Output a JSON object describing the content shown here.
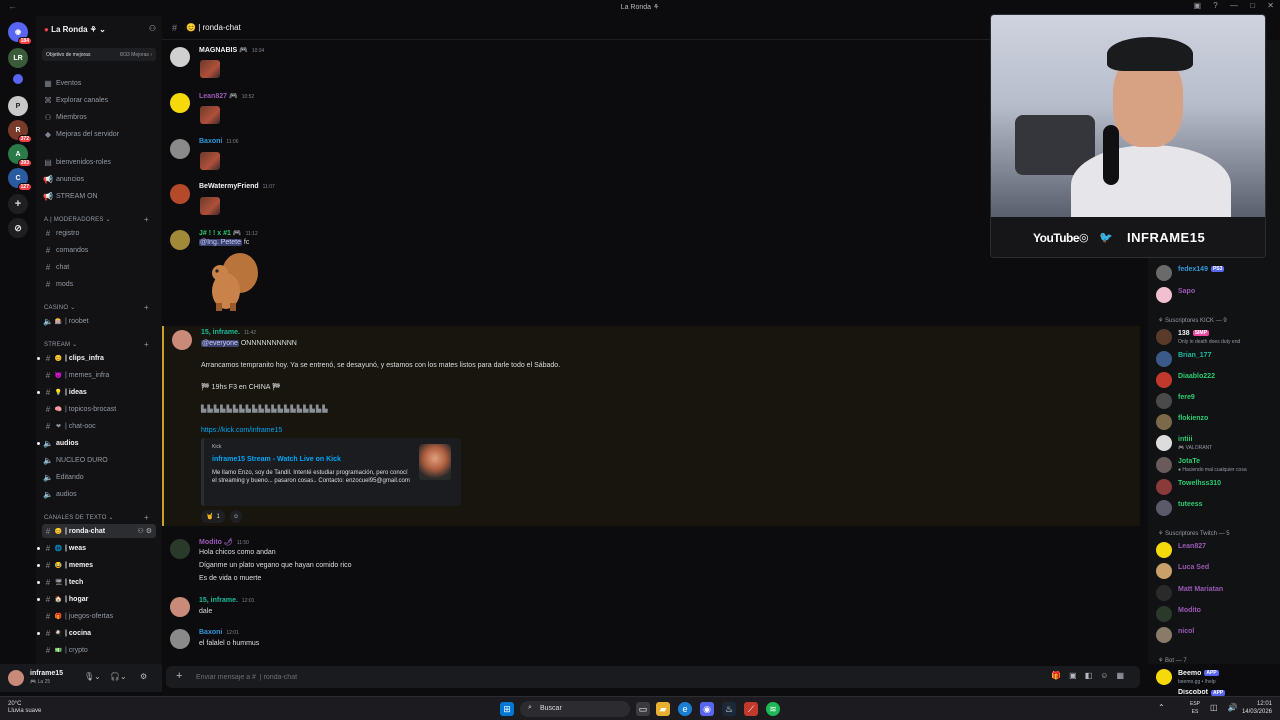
{
  "window": {
    "title": "La Ronda",
    "controls": [
      "—",
      "□",
      "✕"
    ]
  },
  "rail": {
    "servers": [
      {
        "label": "LR",
        "badge": "",
        "color": "#2b2d31"
      },
      {
        "label": "E",
        "badge": "",
        "color": "#5865f2"
      },
      {
        "label": "P",
        "badge": "",
        "color": "#c9c9c9"
      },
      {
        "label": "R",
        "badge": "372",
        "color": "#7a3a2a"
      },
      {
        "label": "A",
        "badge": "393",
        "color": "#2a7a4a"
      },
      {
        "label": "C",
        "badge": "127",
        "color": "#2a5aa0"
      }
    ],
    "top_badge": "184"
  },
  "guild": {
    "name": "La Ronda",
    "goal_label": "Objetivo de mejoras",
    "goal_progress": "8/33 Mejoras"
  },
  "nav_items": [
    {
      "label": "Eventos",
      "icon": "calendar-icon"
    },
    {
      "label": "Explorar canales",
      "icon": "explore-icon"
    },
    {
      "label": "Miembros",
      "icon": "members-icon"
    },
    {
      "label": "Mejoras del servidor",
      "icon": "boost-icon"
    }
  ],
  "channels_top": [
    {
      "label": "bienvenidos-roles",
      "icon": "#"
    },
    {
      "label": "anuncios",
      "icon": "#"
    },
    {
      "label": "STREAM ON",
      "icon": "#"
    }
  ],
  "categories": {
    "mods": "Moderadores",
    "casino": "CASINO",
    "stream": "STREAM",
    "text": "CANALES DE TEXTO"
  },
  "channels_mods": [
    {
      "label": "registro"
    },
    {
      "label": "comandos"
    },
    {
      "label": "chat"
    },
    {
      "label": "mods"
    }
  ],
  "channels_casino": [
    {
      "label": "| roobet"
    }
  ],
  "channels_stream": [
    {
      "label": "| clips_infra",
      "bold": true
    },
    {
      "label": "| memes_infra",
      "bold": false
    },
    {
      "label": "| ideas",
      "bold": true
    },
    {
      "label": "| topicos-brocast",
      "bold": false
    },
    {
      "label": "| chat-ooc",
      "bold": false
    },
    {
      "label": "audios",
      "bold": true
    },
    {
      "label": "NUCLEO DURO",
      "bold": false
    },
    {
      "label": "Editando",
      "bold": false
    },
    {
      "label": "audios",
      "bold": false
    }
  ],
  "channels_text": [
    {
      "label": "| ronda-chat",
      "bold": true,
      "selected": true
    },
    {
      "label": "| weas",
      "bold": true
    },
    {
      "label": "| memes",
      "bold": true
    },
    {
      "label": "| tech",
      "bold": true
    },
    {
      "label": "| hogar",
      "bold": true
    },
    {
      "label": "| juegos-ofertas",
      "bold": false
    },
    {
      "label": "| cocina",
      "bold": true
    },
    {
      "label": "| crypto",
      "bold": false
    }
  ],
  "user": {
    "name": "inframe15",
    "status": "La 25"
  },
  "chat": {
    "channel_title": "| ronda-chat",
    "composer_placeholder": "Enviar mensaje a #  | ronda-chat"
  },
  "messages": [
    {
      "author": "MAGNABIS",
      "time": "10:34",
      "color": "#f2f3f5"
    },
    {
      "author": "Lean827",
      "time": "10:52",
      "color": "#9b59b6"
    },
    {
      "author": "Baxoni",
      "time": "11:06",
      "color": "#3498db"
    },
    {
      "author": "BeWatermyFriend",
      "time": "11:07",
      "color": "#f2f3f5"
    },
    {
      "author": "J# ! ! x #1",
      "time": "11:12",
      "color": "#2ecc71",
      "mention": "@Ing. Petete",
      "text": "fc"
    },
    {
      "author": "15, inframe.",
      "time": "11:42",
      "color": "#1abc9c",
      "mention": "@everyone",
      "headline": "ONNNNNNNNNN",
      "body": "Arrancamos tempranito hoy. Ya se entrenó, se desayunó, y estamos con los mates listos para darle todo el Sábado.",
      "flag_line": "19hs F3 en CHINA",
      "link": "https://kick.com/inframe15",
      "embed": {
        "provider": "Kick",
        "title": "inframe15 Stream - Watch Live on Kick",
        "description": "Me llamo Enzo, soy de Tandil. Intenté estudiar programación, pero conocí el streaming y bueno... pasaron cosas.. Contacto: enzocuel95@gmail.com"
      },
      "reaction_count": "1"
    },
    {
      "author": "Modito",
      "time": "11:50",
      "color": "#9b59b6",
      "lines": [
        "Hola chicos como andan",
        "Díganme un plato vegano que hayan comido rico",
        "Es de vida o muerte"
      ]
    },
    {
      "author": "15, inframe.",
      "time": "12:01",
      "color": "#1abc9c",
      "lines": [
        "dale"
      ]
    },
    {
      "author": "Baxoni",
      "time": "12:01",
      "color": "#3498db",
      "lines": [
        "el falalel o hummus"
      ]
    }
  ],
  "members": {
    "top": [
      {
        "name": "fedex149",
        "color": "#3498db",
        "badge": "PS3"
      },
      {
        "name": "Sapo",
        "color": "#9b59b6",
        "badge": ""
      }
    ],
    "group_kick": "Suscriptores KICK — 9",
    "kick": [
      {
        "name": "138",
        "color": "#f2f3f5",
        "status": "Only in death does duty end",
        "badge": "SIMP"
      },
      {
        "name": "Brian_177",
        "color": "#1abc9c",
        "status": ""
      },
      {
        "name": "Diaablo222",
        "color": "#2ecc71",
        "status": ""
      },
      {
        "name": "fere9",
        "color": "#2ecc71",
        "status": ""
      },
      {
        "name": "flokienzo",
        "color": "#2ecc71",
        "status": ""
      },
      {
        "name": "intiii",
        "color": "#2ecc71",
        "status": "VALORANT"
      },
      {
        "name": "JotaTe",
        "color": "#2ecc71",
        "status": "Haciendo mal cualquier cosa"
      },
      {
        "name": "Towelhss310",
        "color": "#2ecc71",
        "status": ""
      },
      {
        "name": "tuteess",
        "color": "#2ecc71",
        "status": ""
      }
    ],
    "group_twitch": "Suscriptores Twitch — 5",
    "twitch": [
      {
        "name": "Lean827",
        "color": "#9b59b6"
      },
      {
        "name": "Luca Sed",
        "color": "#9b59b6"
      },
      {
        "name": "Matt Mariatan",
        "color": "#9b59b6"
      },
      {
        "name": "Modito",
        "color": "#9b59b6"
      },
      {
        "name": "nicol",
        "color": "#9b59b6"
      }
    ],
    "group_bot": "Bot — 7",
    "bots": [
      {
        "name": "Beemo",
        "color": "#f2f3f5",
        "status": "beemo.gg • /help",
        "badge": "APP"
      },
      {
        "name": "Discobot",
        "color": "#f2f3f5",
        "status": "",
        "badge": "APP"
      }
    ]
  },
  "webcam": {
    "youtube": "YouTube",
    "instagram": "◎",
    "twitter": "🐦",
    "handle": "INFRAME15"
  },
  "taskbar": {
    "weather_temp": "20°C",
    "weather_desc": "Lluvia suave",
    "search": "Buscar",
    "lang": "ESP",
    "lang2": "ES",
    "time": "12:01",
    "date": "14/03/2026"
  }
}
